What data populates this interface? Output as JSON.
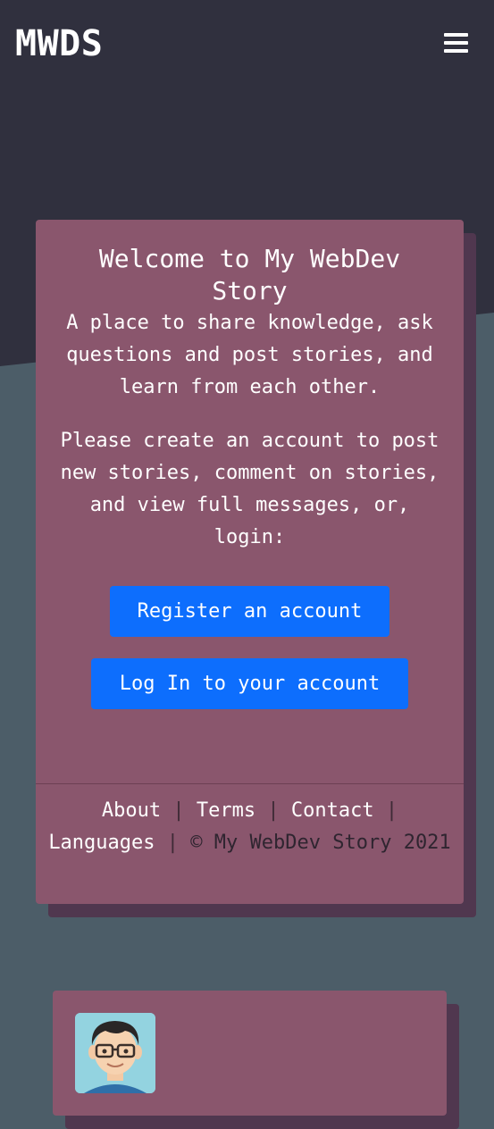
{
  "navbar": {
    "brand": "MWDS",
    "menu_icon": "hamburger-menu-icon"
  },
  "welcome": {
    "title": "Welcome to My WebDev Story",
    "intro": "A place to share knowledge, ask questions and post stories, and learn from each other.",
    "prompt": "Please create an account to post new stories, comment on stories, and view full messages, or, login:",
    "register_button": "Register an account",
    "login_button": "Log In to your account"
  },
  "footer": {
    "links": {
      "about": "About",
      "terms": "Terms",
      "contact": "Contact",
      "languages": "Languages"
    },
    "separator": "|",
    "copyright": "© My WebDev Story 2021"
  },
  "story_card": {
    "avatar": "user-avatar-icon"
  },
  "colors": {
    "header_bg": "#30303e",
    "page_bg": "#4c5d68",
    "card_bg": "#8a566d",
    "card_shadow": "#50374f",
    "button": "#0d6efd"
  }
}
